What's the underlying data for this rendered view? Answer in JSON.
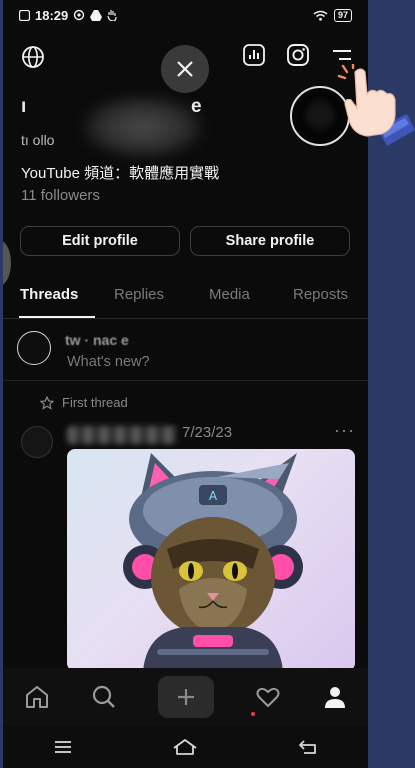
{
  "status": {
    "time": "18:29",
    "battery": "97"
  },
  "profile": {
    "name_fragment_left": "ı",
    "name_fragment_right": "e",
    "handle": "tı   ollo",
    "bio": "YouTube 頻道：軟體應用實戰",
    "followers": "11 followers"
  },
  "buttons": {
    "edit": "Edit profile",
    "share": "Share profile"
  },
  "tabs": [
    {
      "label": "Threads"
    },
    {
      "label": "Replies"
    },
    {
      "label": "Media"
    },
    {
      "label": "Reposts"
    }
  ],
  "composer": {
    "name": "tw    ·  nac  e",
    "placeholder": "What's new?"
  },
  "pinned": {
    "label": "First thread"
  },
  "post": {
    "date": "7/23/23",
    "more": "···"
  },
  "colors": {
    "background": "#0b0b0b",
    "outer": "#2b3a64",
    "notification_dot": "#ff3040"
  }
}
